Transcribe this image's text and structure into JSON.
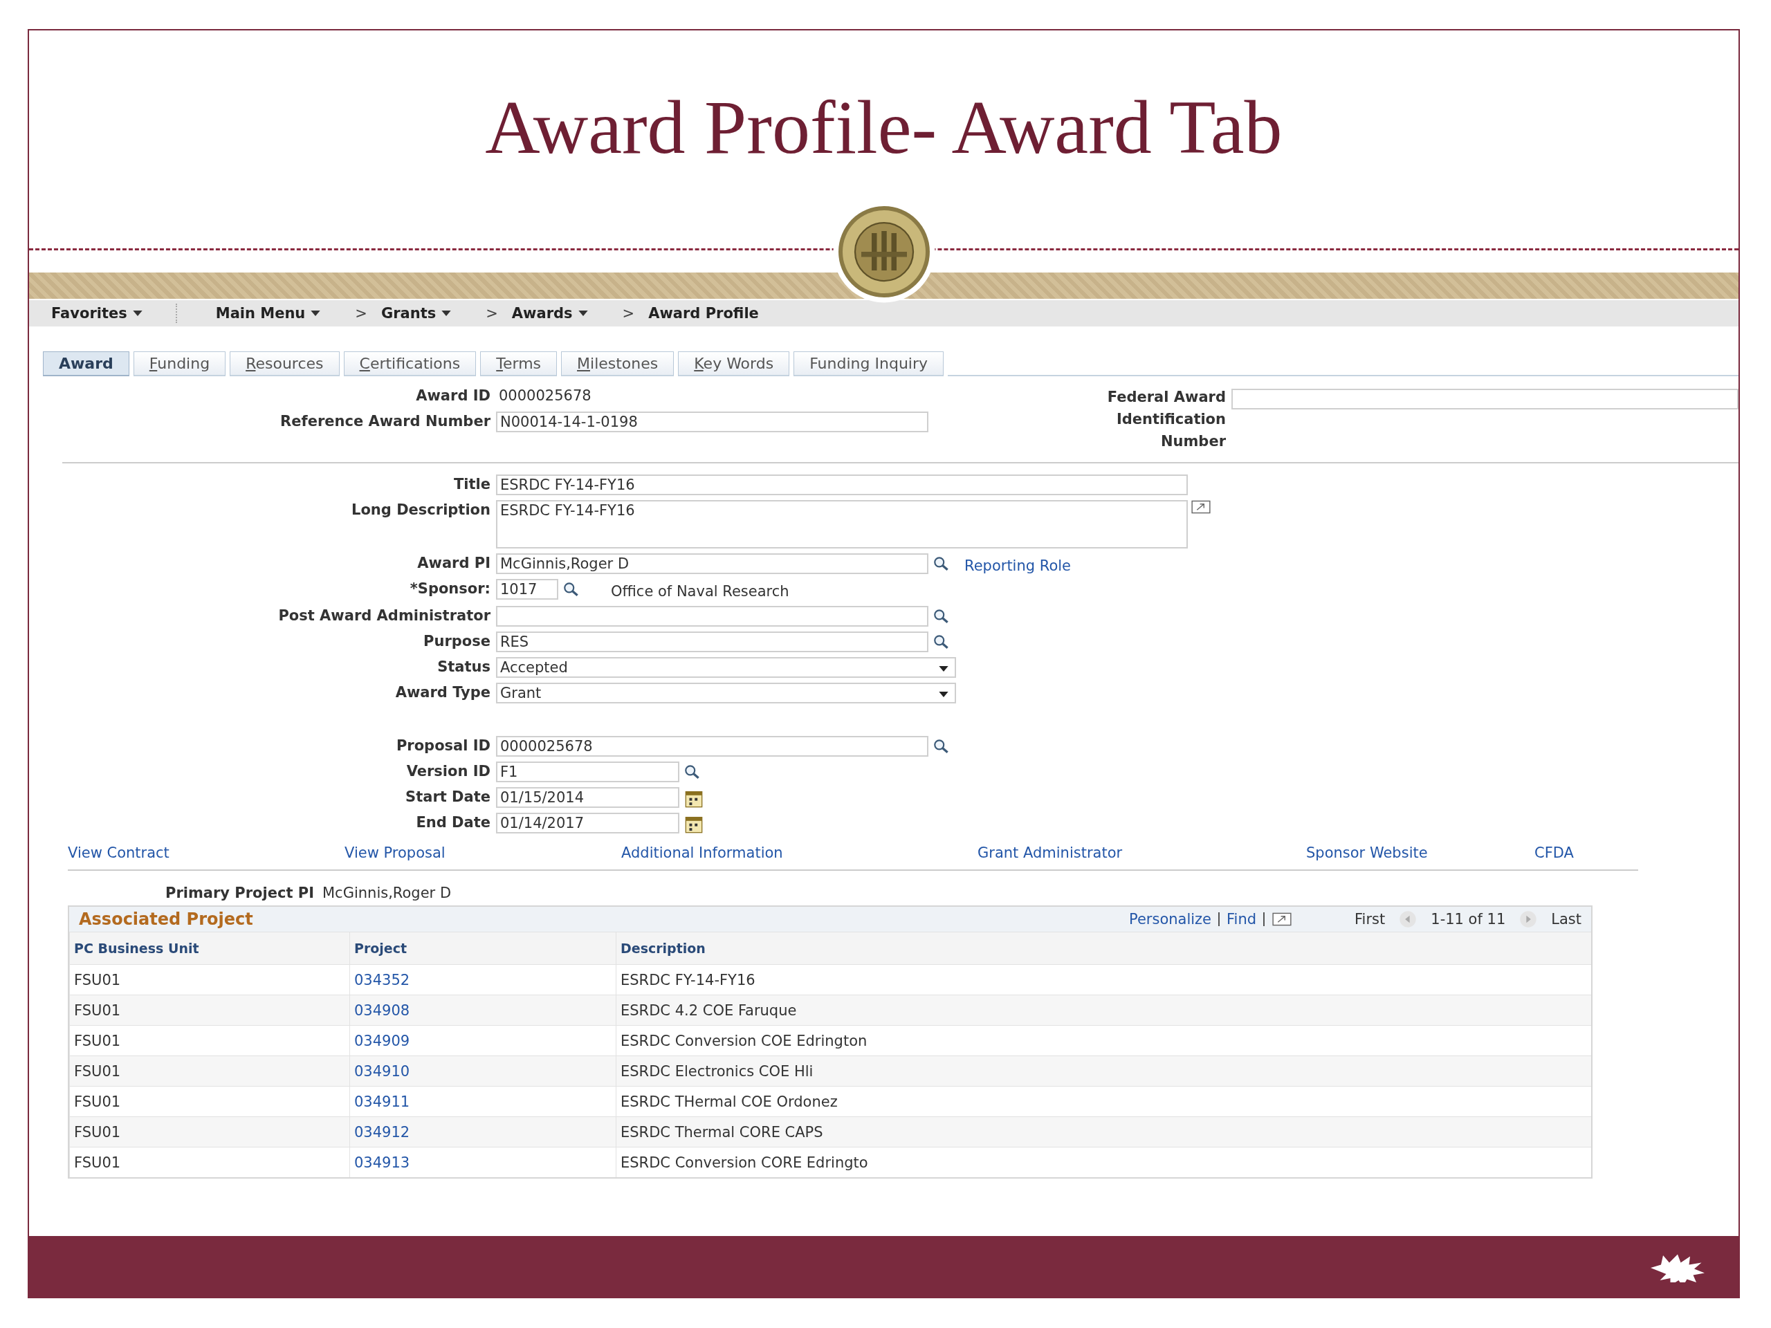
{
  "slide": {
    "title": "Award Profile- Award Tab"
  },
  "nav": [
    {
      "label": "Favorites",
      "dropdown": true
    },
    {
      "label": "Main Menu",
      "dropdown": true
    },
    {
      "prefix": ">",
      "label": "Grants",
      "dropdown": true
    },
    {
      "prefix": ">",
      "label": "Awards",
      "dropdown": true
    },
    {
      "prefix": ">",
      "label": "Award Profile",
      "dropdown": false
    }
  ],
  "tabs": [
    {
      "label": "Award",
      "selected": true,
      "accesskey": false
    },
    {
      "label": "Funding",
      "selected": false,
      "accesskey": true
    },
    {
      "label": "Resources",
      "selected": false,
      "accesskey": true
    },
    {
      "label": "Certifications",
      "selected": false,
      "accesskey": true
    },
    {
      "label": "Terms",
      "selected": false,
      "accesskey": true
    },
    {
      "label": "Milestones",
      "selected": false,
      "accesskey": true
    },
    {
      "label": "Key Words",
      "selected": false,
      "accesskey": true
    },
    {
      "label": "Funding Inquiry",
      "selected": false,
      "accesskey": false
    }
  ],
  "federal_award": {
    "label": "Federal Award Identification Number"
  },
  "fields": [
    {
      "kind": "text",
      "label": "Award ID",
      "value": "0000025678"
    },
    {
      "kind": "input",
      "label": "Reference Award Number",
      "value": "N00014-14-1-0198"
    },
    {
      "kind": "input",
      "label": "Title",
      "value": "ESRDC FY-14-FY16"
    },
    {
      "kind": "textarea",
      "label": "Long Description",
      "value": "ESRDC FY-14-FY16"
    },
    {
      "kind": "lookup",
      "label": "Award PI",
      "value": "McGinnis,Roger D",
      "link": "Reporting Role"
    },
    {
      "kind": "lookup",
      "label": "*Sponsor:",
      "value": "1017",
      "note": "Office of Naval Research"
    },
    {
      "kind": "lookup",
      "label": "Post Award Administrator"
    },
    {
      "kind": "lookup",
      "label": "Purpose",
      "value": "RES"
    },
    {
      "kind": "select",
      "label": "Status",
      "value": "Accepted"
    },
    {
      "kind": "select",
      "label": "Award Type",
      "value": "Grant"
    },
    {
      "kind": "lookup",
      "label": "Proposal ID",
      "value": "0000025678"
    },
    {
      "kind": "lookup",
      "label": "Version ID",
      "value": "F1"
    },
    {
      "kind": "date",
      "label": "Start Date",
      "value": "01/15/2014"
    },
    {
      "kind": "date",
      "label": "End Date",
      "value": "01/14/2017"
    }
  ],
  "links": [
    "View Contract",
    "View Proposal",
    "Additional Information",
    "Grant Administrator",
    "Sponsor Website",
    "CFDA"
  ],
  "primary_project_pi": {
    "label": "Primary Project PI",
    "value": "McGinnis,Roger D"
  },
  "grid": {
    "title": "Associated Project",
    "personalize": "Personalize",
    "find": "Find",
    "first": "First",
    "range": "1-11 of 11",
    "last": "Last",
    "columns": [
      "PC Business Unit",
      "Project",
      "Description"
    ],
    "rows": [
      [
        "FSU01",
        "034352",
        "ESRDC FY-14-FY16"
      ],
      [
        "FSU01",
        "034908",
        "ESRDC 4.2 COE Faruque"
      ],
      [
        "FSU01",
        "034909",
        "ESRDC Conversion COE Edrington"
      ],
      [
        "FSU01",
        "034910",
        "ESRDC Electronics COE Hli"
      ],
      [
        "FSU01",
        "034911",
        "ESRDC THermal COE Ordonez"
      ],
      [
        "FSU01",
        "034912",
        "ESRDC Thermal CORE CAPS"
      ],
      [
        "FSU01",
        "034913",
        "ESRDC Conversion CORE Edringto"
      ]
    ]
  }
}
